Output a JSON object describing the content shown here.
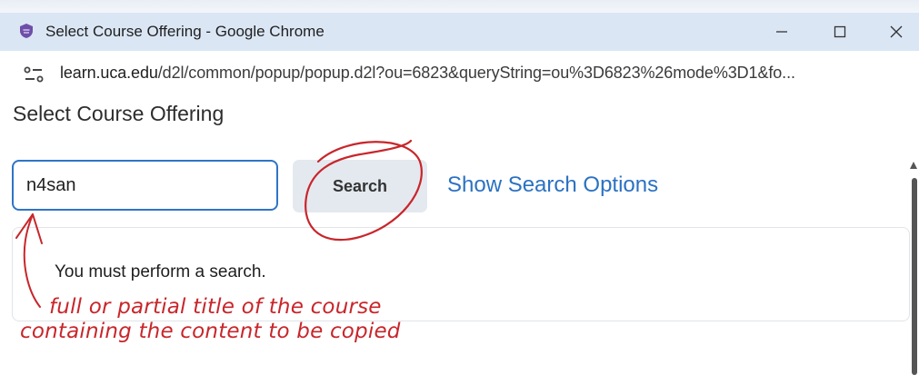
{
  "browser": {
    "window_title": "Select Course Offering - Google Chrome",
    "url_host": "learn.uca.edu",
    "url_path": "/d2l/common/popup/popup.d2l?ou=6823&queryString=ou%3D6823%26mode%3D1&fo...",
    "icons": {
      "favicon": "shield-icon",
      "site_info": "tune-icon",
      "minimize": "minimize-icon",
      "maximize": "maximize-icon",
      "close": "close-icon"
    }
  },
  "page": {
    "title": "Select Course Offering"
  },
  "search": {
    "value": "n4san",
    "button_label": "Search",
    "options_link": "Show Search Options"
  },
  "results": {
    "message": "You must perform a search."
  },
  "annotation": {
    "line1": "full or partial title of the course",
    "line2": "containing the content to be copied",
    "color": "#c8262b"
  },
  "colors": {
    "titlebar": "#dbe6f5",
    "accent_blue": "#2b72c2",
    "input_border": "#2f74c6",
    "button_bg": "#e4e9ef"
  }
}
